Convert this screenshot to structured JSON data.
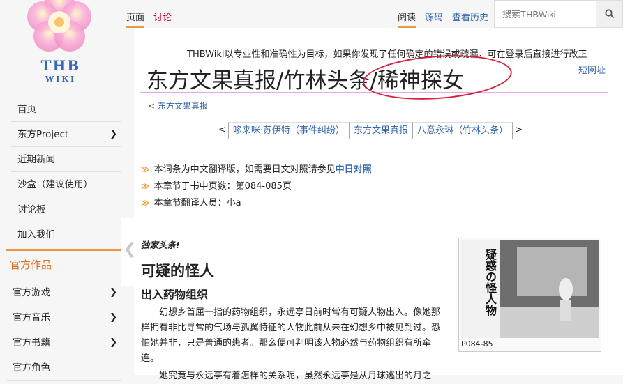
{
  "logo": {
    "text": "THB",
    "sub": "WIKI"
  },
  "sidebar": {
    "items": [
      {
        "label": "首页",
        "chevron": false
      },
      {
        "label": "东方Project",
        "chevron": true
      },
      {
        "label": "近期新闻",
        "chevron": false
      },
      {
        "label": "沙盒（建议使用）",
        "chevron": false
      },
      {
        "label": "讨论板",
        "chevron": false
      },
      {
        "label": "加入我们",
        "chevron": false
      }
    ],
    "section_title": "官方作品",
    "section_items": [
      {
        "label": "官方游戏",
        "chevron": true
      },
      {
        "label": "官方音乐",
        "chevron": true
      },
      {
        "label": "官方书籍",
        "chevron": true
      },
      {
        "label": "官方角色",
        "chevron": false
      }
    ],
    "chevron_glyph": "❯"
  },
  "tabs": {
    "page": "页面",
    "talk": "讨论",
    "read": "阅读",
    "source": "源码",
    "history": "查看历史"
  },
  "search": {
    "placeholder": "搜索THBWiki"
  },
  "content": {
    "notice": "THBWiki以专业性和准确性为目标，如果你发现了任何确定的错误或疏漏，可在登录后直接进行改正",
    "title": "东方文果真报/竹林头条/稀神探女",
    "shortlink": "短网址",
    "breadcrumb_prefix": "<",
    "breadcrumb_link": "东方文果真报",
    "nav": {
      "prev_arrow": "<",
      "prev": "哆来咪·苏伊特（事件纠纷）",
      "center": "东方文果真报",
      "next": "八意永琳（竹林头条）",
      "next_arrow": ">"
    },
    "info": [
      {
        "text": "本词条为中文翻译版，如需要日文对照请参见",
        "link": "中日对照"
      },
      {
        "text": "本章节于书中页数：第084-085页",
        "link": ""
      },
      {
        "text": "本章节翻译人员：小a",
        "link": ""
      }
    ],
    "info_bullet": "≫",
    "headline": "独家头条!",
    "h1": "可疑的怪人",
    "h2": "出入药物组织",
    "paragraph": "幻想乡首屈一指的药物组织，永远亭日前时常有可疑人物出入。像她那样拥有非比寻常的气场与孤翼特征的人物此前从未在幻想乡中被见到过。恐怕她并非，只是普通的患者。那么便可判明该人物必然与药物组织有所牵连。",
    "paragraph2": "她究竟与永远亭有着怎样的关系呢，虽然永远亭是从月球逃出的月之",
    "figure": {
      "caption": "P084-85",
      "img_text": "疑惑の怪人物"
    }
  },
  "colors": {
    "accent": "#e89a3c",
    "link": "#3366aa",
    "circle": "#d2233a"
  }
}
